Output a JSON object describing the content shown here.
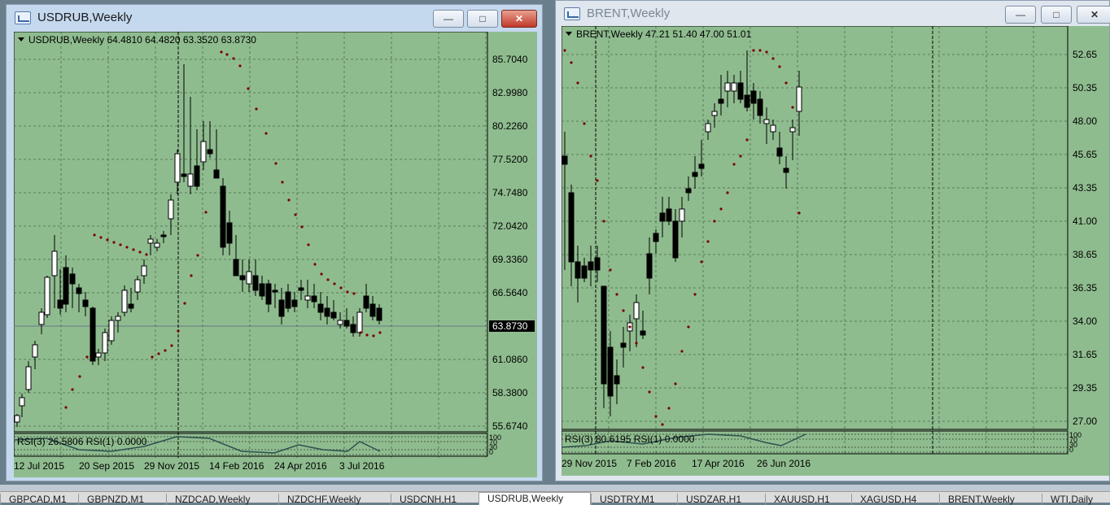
{
  "windows": [
    {
      "title": "USDRUB,Weekly",
      "header": "USDRUB,Weekly  64.4810 64.4820 63.3520 63.8730",
      "rsi_label": "RSI(3) 26.5806  RSI(1) 0.0000",
      "price_labels": [
        "85.7040",
        "82.9980",
        "80.2260",
        "77.5200",
        "74.7480",
        "72.0420",
        "69.3360",
        "66.5640",
        "63.8730",
        "61.0860",
        "58.3800",
        "55.6740"
      ],
      "current_price": "63.8730",
      "rsi_labels": [
        "100",
        "70",
        "30",
        "0"
      ],
      "date_labels": [
        "12 Jul 2015",
        "20 Sep 2015",
        "29 Nov 2015",
        "14 Feb 2016",
        "24 Apr 2016",
        "3 Jul 2016"
      ]
    },
    {
      "title": "BRENT,Weekly",
      "header": "BRENT,Weekly  47.21 51.40 47.00 51.01",
      "rsi_label": "RSI(3) 80.6195  RSI(1) 0.0000",
      "price_labels": [
        "52.65",
        "50.35",
        "48.00",
        "45.65",
        "43.35",
        "41.00",
        "38.65",
        "36.35",
        "34.00",
        "31.65",
        "29.35",
        "27.00"
      ],
      "current_price": "51.01",
      "rsi_labels": [
        "100",
        "70",
        "30",
        "0"
      ],
      "date_labels": [
        "29 Nov 2015",
        "7 Feb 2016",
        "17 Apr 2016",
        "26 Jun 2016"
      ]
    }
  ],
  "taskbar": {
    "tabs": [
      "GBPCAD,M1",
      "GBPNZD,M1",
      "NZDCAD,Weekly",
      "NZDCHF,Weekly",
      "USDCNH,H1",
      "USDRUB,Weekly",
      "USDTRY,M1",
      "USDZAR,H1",
      "XAUUSD,H1",
      "XAGUSD,H4",
      "BRENT,Weekly",
      "WTI,Daily"
    ],
    "active_index": 5
  },
  "colors": {
    "chart_bg": "#8fbc8f",
    "grid": "#4a6a4a",
    "candle_up": "#ffffff",
    "candle_down": "#000000",
    "sar": "#7a0000",
    "rsi_line": "#2f4f4f"
  }
}
